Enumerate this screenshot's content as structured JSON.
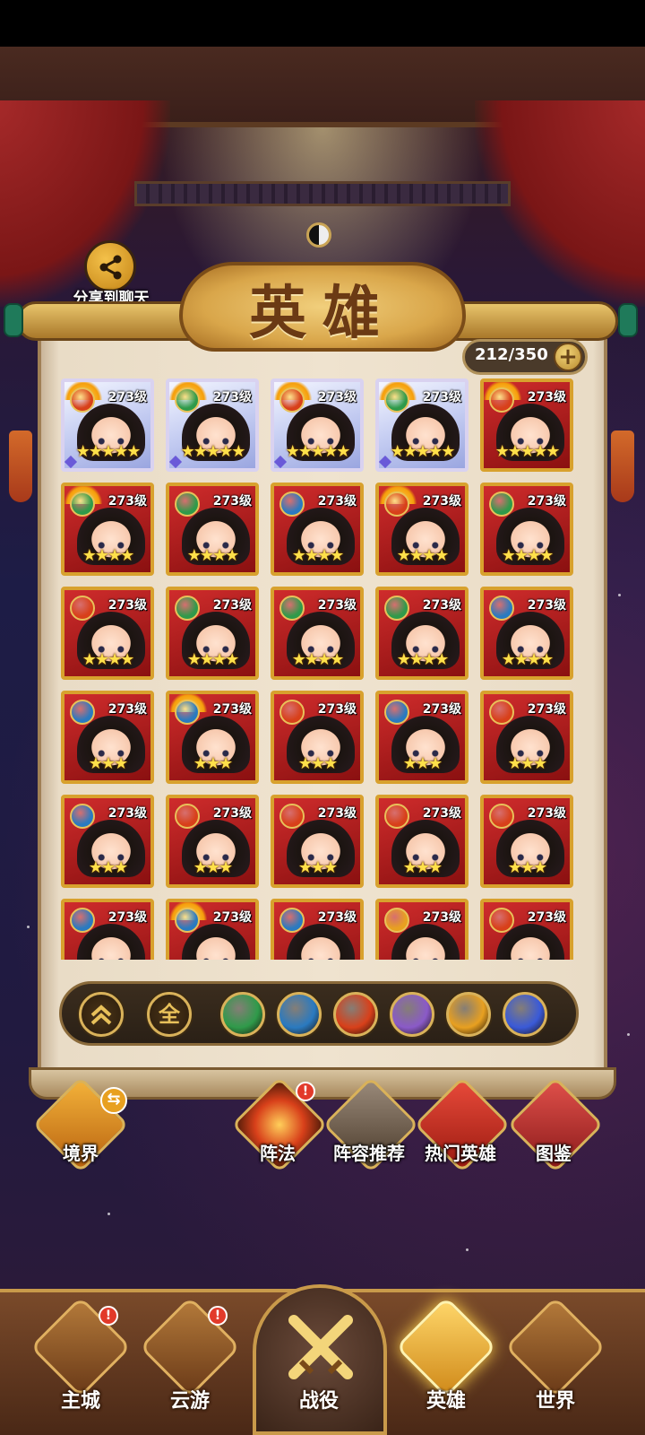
{
  "share": {
    "label": "分享到聊天",
    "icon": "share-icon"
  },
  "header": {
    "title": "英雄",
    "hero_count": "212/350",
    "add_label": "+"
  },
  "hero_grid": {
    "cards": [
      {
        "level": "273级",
        "stars": "★★★★★",
        "element": "fire",
        "awakened": true,
        "rarity": "legendary"
      },
      {
        "level": "273级",
        "stars": "★★★★★",
        "element": "wood",
        "awakened": true,
        "rarity": "legendary"
      },
      {
        "level": "273级",
        "stars": "★★★★★",
        "element": "fire",
        "awakened": true,
        "rarity": "legendary"
      },
      {
        "level": "273级",
        "stars": "★★★★★",
        "element": "wood",
        "awakened": true,
        "rarity": "legendary"
      },
      {
        "level": "273级",
        "stars": "★★★★★",
        "element": "fire",
        "awakened": true,
        "rarity": "epic"
      },
      {
        "level": "273级",
        "stars": "★★★★",
        "element": "wood",
        "awakened": true,
        "rarity": "epic"
      },
      {
        "level": "273级",
        "stars": "★★★★",
        "element": "wood",
        "awakened": false,
        "rarity": "epic"
      },
      {
        "level": "273级",
        "stars": "★★★★",
        "element": "water",
        "awakened": false,
        "rarity": "epic"
      },
      {
        "level": "273级",
        "stars": "★★★★",
        "element": "fire",
        "awakened": true,
        "rarity": "epic"
      },
      {
        "level": "273级",
        "stars": "★★★★",
        "element": "wood",
        "awakened": false,
        "rarity": "epic"
      },
      {
        "level": "273级",
        "stars": "★★★★",
        "element": "fire",
        "awakened": false,
        "rarity": "epic"
      },
      {
        "level": "273级",
        "stars": "★★★★",
        "element": "wood",
        "awakened": false,
        "rarity": "epic"
      },
      {
        "level": "273级",
        "stars": "★★★★",
        "element": "wood",
        "awakened": false,
        "rarity": "epic"
      },
      {
        "level": "273级",
        "stars": "★★★★",
        "element": "wood",
        "awakened": false,
        "rarity": "epic"
      },
      {
        "level": "273级",
        "stars": "★★★★",
        "element": "water",
        "awakened": false,
        "rarity": "epic"
      },
      {
        "level": "273级",
        "stars": "★★★",
        "element": "water",
        "awakened": false,
        "rarity": "epic"
      },
      {
        "level": "273级",
        "stars": "★★★",
        "element": "water",
        "awakened": true,
        "rarity": "epic"
      },
      {
        "level": "273级",
        "stars": "★★★",
        "element": "fire",
        "awakened": false,
        "rarity": "epic"
      },
      {
        "level": "273级",
        "stars": "★★★",
        "element": "water",
        "awakened": false,
        "rarity": "epic"
      },
      {
        "level": "273级",
        "stars": "★★★",
        "element": "fire",
        "awakened": false,
        "rarity": "epic"
      },
      {
        "level": "273级",
        "stars": "★★★",
        "element": "water",
        "awakened": false,
        "rarity": "epic"
      },
      {
        "level": "273级",
        "stars": "★★★",
        "element": "fire",
        "awakened": false,
        "rarity": "epic"
      },
      {
        "level": "273级",
        "stars": "★★★",
        "element": "fire",
        "awakened": false,
        "rarity": "epic"
      },
      {
        "level": "273级",
        "stars": "★★★",
        "element": "fire",
        "awakened": false,
        "rarity": "epic"
      },
      {
        "level": "273级",
        "stars": "★★★",
        "element": "fire",
        "awakened": false,
        "rarity": "epic"
      },
      {
        "level": "273级",
        "stars": "",
        "element": "water",
        "awakened": false,
        "rarity": "epic"
      },
      {
        "level": "273级",
        "stars": "",
        "element": "water",
        "awakened": true,
        "rarity": "epic"
      },
      {
        "level": "273级",
        "stars": "",
        "element": "water",
        "awakened": false,
        "rarity": "epic"
      },
      {
        "level": "273级",
        "stars": "",
        "element": "light",
        "awakened": false,
        "rarity": "epic"
      },
      {
        "level": "273级",
        "stars": "",
        "element": "fire",
        "awakened": false,
        "rarity": "epic"
      }
    ]
  },
  "filters": {
    "collapse_icon": "chevron-up-icon",
    "all_label": "全",
    "elements": [
      {
        "name": "wood",
        "icon": "leaf-icon",
        "color": "#2f9a4a"
      },
      {
        "name": "water",
        "icon": "wave-icon",
        "color": "#2a7ac0"
      },
      {
        "name": "fire",
        "icon": "flame-icon",
        "color": "#d8401a"
      },
      {
        "name": "dark",
        "icon": "moon-icon",
        "color": "#8a5ac8"
      },
      {
        "name": "light",
        "icon": "sun-icon",
        "color": "#e8a020"
      },
      {
        "name": "void",
        "icon": "vortex-icon",
        "color": "#3a5ad8"
      }
    ]
  },
  "side_actions": {
    "realm": {
      "label": "境界",
      "badge_icon": "swap-icon"
    },
    "formation": {
      "label": "阵法",
      "badge": "!"
    },
    "lineup": {
      "label": "阵容推荐"
    },
    "hot_heroes": {
      "label": "热门英雄"
    },
    "codex": {
      "label": "图鉴"
    }
  },
  "bottom_nav": {
    "items": [
      {
        "label": "主城",
        "badge": "!",
        "icon": "palace-icon"
      },
      {
        "label": "云游",
        "badge": "!",
        "icon": "gourd-icon"
      },
      {
        "label": "战役",
        "icon": "crossed-swords-icon"
      },
      {
        "label": "英雄",
        "icon": "hero-helmet-icon",
        "active": true
      },
      {
        "label": "世界",
        "icon": "mountain-icon"
      }
    ]
  },
  "colors": {
    "wood": "#2f9a4a",
    "water": "#2a7ac0",
    "fire": "#d8401a",
    "light": "#e8a020",
    "dark": "#8a5ac8",
    "void": "#3a5ad8",
    "accent_gold": "#d8a12d",
    "card_red": "#cf2c2c"
  }
}
